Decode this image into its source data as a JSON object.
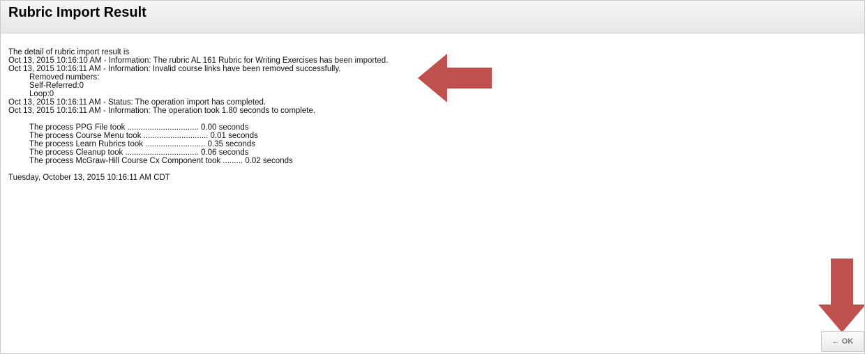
{
  "header": {
    "title": "Rubric Import Result"
  },
  "content": {
    "intro": "The detail of rubric import result is",
    "log": [
      "Oct 13, 2015 10:16:10 AM - Information: The rubric AL 161 Rubric for Writing Exercises has been imported.",
      "Oct 13, 2015 10:16:11 AM - Information: Invalid course links have been removed successfully."
    ],
    "removed": [
      "Removed numbers:",
      "Self-Referred:0",
      "Loop:0"
    ],
    "status": [
      "Oct 13, 2015 10:16:11 AM - Status: The operation import has completed.",
      "Oct 13, 2015 10:16:11 AM - Information: The operation took 1.80 seconds to complete."
    ],
    "processes": [
      "The process PPG File took ................................ 0.00 seconds",
      "The process Course Menu took ............................. 0.01 seconds",
      "The process Learn Rubrics took ........................... 0.35 seconds",
      "The process Cleanup took ................................. 0.06 seconds",
      "The process McGraw-Hill Course Cx Component took ......... 0.02 seconds"
    ],
    "timestamp": "Tuesday, October 13, 2015 10:16:11 AM CDT"
  },
  "ok_button": {
    "icon": "left-arrow-icon",
    "glyph": "←",
    "label": "OK"
  },
  "annotations": {
    "arrow_color": "#c0504d"
  }
}
